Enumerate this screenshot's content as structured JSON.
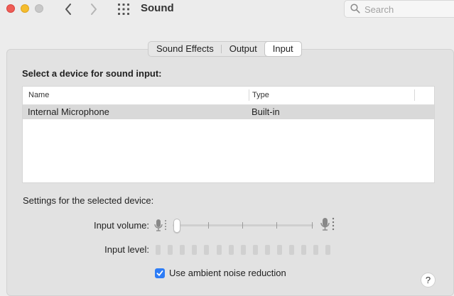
{
  "window": {
    "title": "Sound"
  },
  "search": {
    "placeholder": "Search"
  },
  "tabs": [
    {
      "label": "Sound Effects"
    },
    {
      "label": "Output"
    },
    {
      "label": "Input"
    }
  ],
  "active_tab": "Input",
  "input": {
    "heading": "Select a device for sound input:",
    "table": {
      "columns": [
        "Name",
        "Type"
      ],
      "rows": [
        {
          "name": "Internal Microphone",
          "type": "Built-in",
          "selected": true
        }
      ]
    },
    "settings_label": "Settings for the selected device:",
    "volume_label": "Input volume:",
    "volume_value": 0.02,
    "level_label": "Input level:",
    "level_value": 0,
    "noise_reduction_label": "Use ambient noise reduction",
    "noise_reduction_checked": true
  },
  "help": {
    "label": "?"
  },
  "colors": {
    "accent": "#2d7cf6",
    "selected_row": "#d9d9d9"
  }
}
